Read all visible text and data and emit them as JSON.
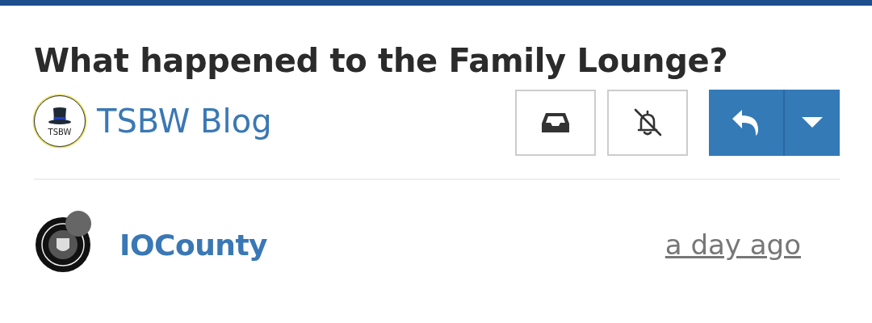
{
  "topic": {
    "title": "What happened to the Family Lounge?"
  },
  "category": {
    "logo_text": "TSBW",
    "name": "TSBW Blog"
  },
  "actions": {
    "bookmark_muted": true
  },
  "post": {
    "author": "IOCounty",
    "online": false,
    "time": "a day ago"
  }
}
